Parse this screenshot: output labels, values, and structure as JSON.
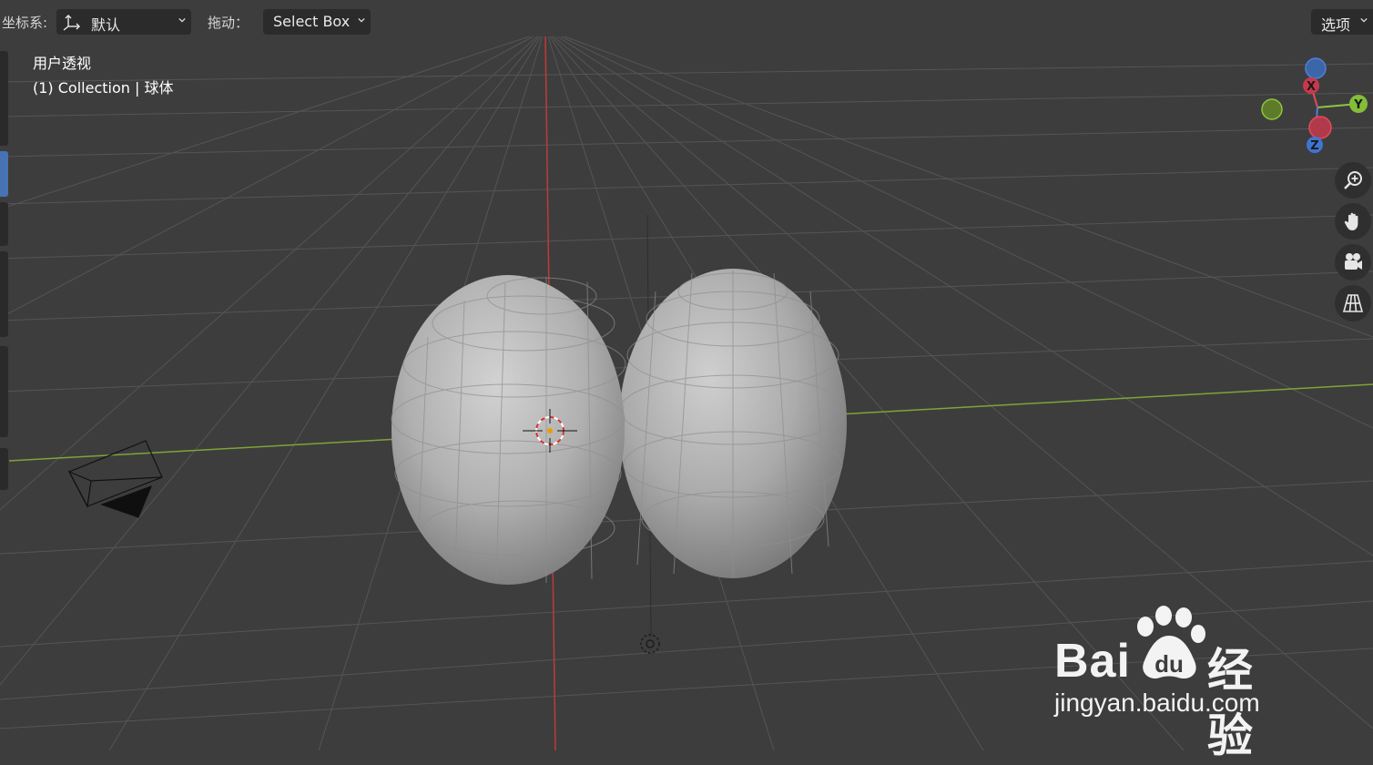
{
  "header": {
    "coord_label": "坐标系:",
    "coord_value": "默认",
    "drag_label": "拖动：",
    "drag_value": "Select Box",
    "options_label": "选项"
  },
  "viewport_info": {
    "view_name": "用户透视",
    "collection_line": "(1) Collection | 球体"
  },
  "gizmo": {
    "axes": [
      {
        "label": "X",
        "color": "#e34b5d"
      },
      {
        "label": "Y",
        "color": "#8cc63f"
      },
      {
        "label": "Z",
        "color": "#4f80d9"
      }
    ]
  },
  "nav_buttons": [
    {
      "name": "zoom-icon"
    },
    {
      "name": "hand-pan-icon"
    },
    {
      "name": "camera-view-icon"
    },
    {
      "name": "perspective-grid-icon"
    }
  ],
  "watermark": {
    "brand": "Bai",
    "brand_cn": "经验",
    "url": "jingyan.baidu.com"
  },
  "colors": {
    "background": "#3d3d3d",
    "grid": "#5a5a5a",
    "x_axis_line": "#c03a3a",
    "y_axis_line": "#7ea43a",
    "mesh": "#a9a9a9",
    "accent_tab": "#4772b3"
  }
}
